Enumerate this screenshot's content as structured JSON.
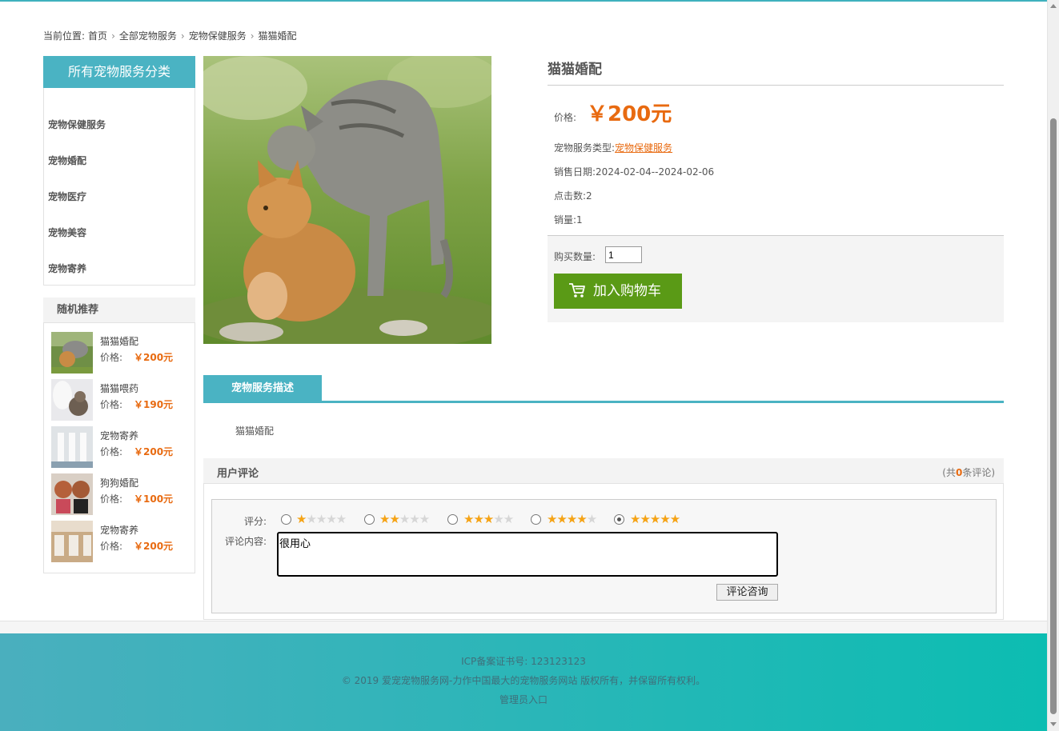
{
  "breadcrumb": {
    "prefix": "当前位置:",
    "items": [
      "首页",
      "全部宠物服务",
      "宠物保健服务",
      "猫猫婚配"
    ],
    "separator": ">"
  },
  "sidebar": {
    "categories_title": "所有宠物服务分类",
    "categories": [
      "宠物保健服务",
      "宠物婚配",
      "宠物医疗",
      "宠物美容",
      "宠物寄养"
    ],
    "recommend_title": "随机推荐",
    "price_label": "价格:",
    "recommendations": [
      {
        "name": "猫猫婚配",
        "price": "￥200元",
        "thumb": "cats"
      },
      {
        "name": "猫猫喂药",
        "price": "￥190元",
        "thumb": "vet"
      },
      {
        "name": "宠物寄养",
        "price": "￥200元",
        "thumb": "kennel"
      },
      {
        "name": "狗狗婚配",
        "price": "￥100元",
        "thumb": "dogs"
      },
      {
        "name": "宠物寄养",
        "price": "￥200元",
        "thumb": "room"
      }
    ]
  },
  "product": {
    "name": "猫猫婚配",
    "price_label": "价格:",
    "price": "￥200元",
    "type_label": "宠物服务类型:",
    "type_value": "宠物保健服务",
    "sale_date_label": "销售日期:",
    "sale_date": "2024-02-04--2024-02-06",
    "clicks_label": "点击数:",
    "clicks": "2",
    "sales_label": "销量:",
    "sales": "1",
    "qty_label": "购买数量:",
    "qty_value": "1",
    "add_to_cart": "加入购物车"
  },
  "description": {
    "tab_label": "宠物服务描述",
    "text": "猫猫婚配"
  },
  "comments": {
    "title": "用户评论",
    "count_prefix": "(共",
    "count": "0",
    "count_suffix": "条评论)",
    "score_label": "评分:",
    "ratings": [
      1,
      2,
      3,
      4,
      5
    ],
    "selected_rating": 5,
    "content_label": "评论内容:",
    "content_value": "很用心",
    "submit_label": "评论咨询"
  },
  "footer": {
    "icp": "ICP备案证书号: 123123123",
    "copyright": "© 2019 爱宠宠物服务网-力作中国最大的宠物服务网站 版权所有，并保留所有权利。",
    "admin_link": "管理员入口"
  },
  "colors": {
    "accent": "#4ab3c3",
    "price": "#e86a10",
    "cart_button": "#5a9a16",
    "star": "#f5a315"
  }
}
